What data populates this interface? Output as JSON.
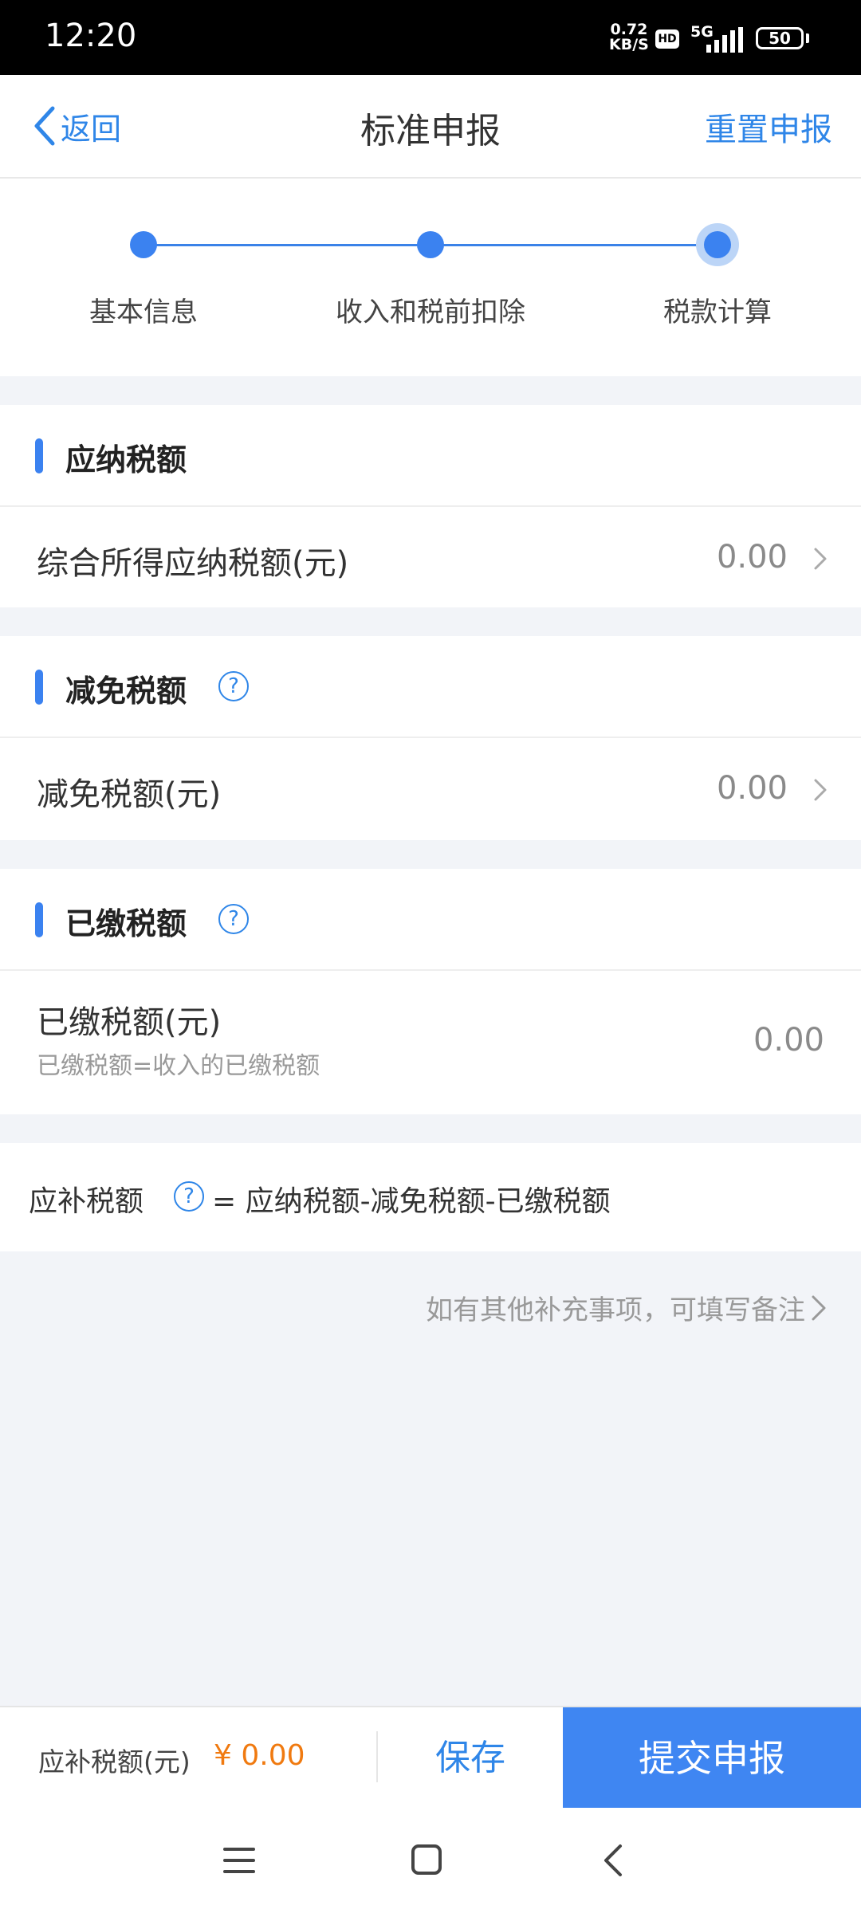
{
  "status_bar": {
    "time": "12:20",
    "net_speed_value": "0.72",
    "net_speed_unit": "KB/S",
    "hd": "HD",
    "network": "5G",
    "battery": "50"
  },
  "nav": {
    "back_label": "返回",
    "title": "标准申报",
    "reset_label": "重置申报"
  },
  "steps": [
    {
      "label": "基本信息"
    },
    {
      "label": "收入和税前扣除"
    },
    {
      "label": "税款计算"
    }
  ],
  "sections": {
    "payable": {
      "title": "应纳税额",
      "row_label": "综合所得应纳税额(元)",
      "row_value": "0.00"
    },
    "reduction": {
      "title": "减免税额",
      "row_label": "减免税额(元)",
      "row_value": "0.00"
    },
    "paid": {
      "title": "已缴税额",
      "row_label": "已缴税额(元)",
      "row_sublabel": "已缴税额=收入的已缴税额",
      "row_value": "0.00"
    }
  },
  "formula": {
    "label": "应补税额",
    "text": "= 应纳税额-减免税额-已缴税额"
  },
  "remark_link": "如有其他补充事项，可填写备注",
  "bottom_bar": {
    "due_label": "应补税额(元)",
    "due_value": "¥ 0.00",
    "save_label": "保存",
    "submit_label": "提交申报"
  },
  "colors": {
    "accent": "#2f86e8",
    "submit_bg": "#3f86f2",
    "due_value": "#f07a10"
  }
}
